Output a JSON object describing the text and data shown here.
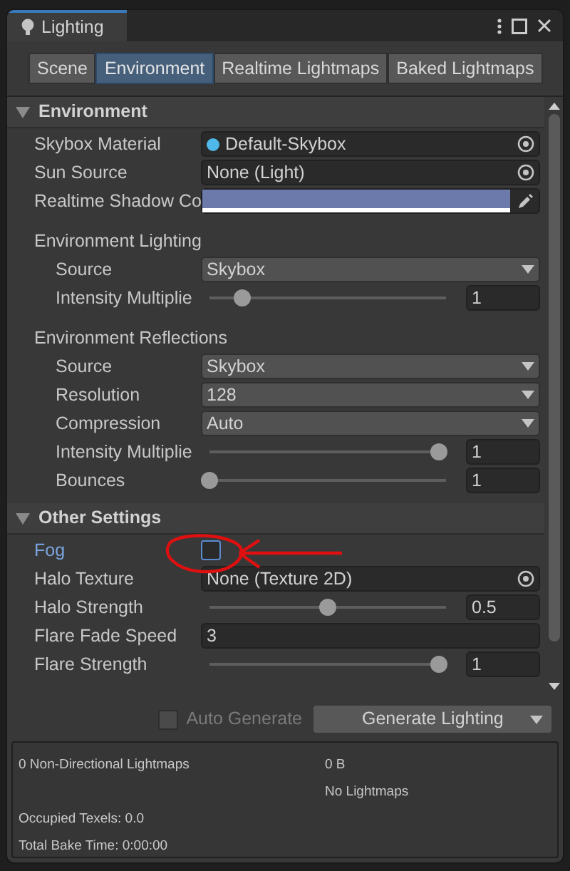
{
  "window": {
    "title": "Lighting"
  },
  "tabs": [
    {
      "label": "Scene",
      "selected": false
    },
    {
      "label": "Environment",
      "selected": true
    },
    {
      "label": "Realtime Lightmaps",
      "selected": false
    },
    {
      "label": "Baked Lightmaps",
      "selected": false
    }
  ],
  "sections": [
    {
      "title": "Environment",
      "expanded": true,
      "rows": [
        {
          "kind": "material",
          "label": "Skybox Material",
          "value": "Default-Skybox"
        },
        {
          "kind": "object",
          "label": "Sun Source",
          "value": "None (Light)"
        },
        {
          "kind": "color",
          "label": "Realtime Shadow Co",
          "color": "#6b7aab"
        },
        {
          "kind": "heading",
          "label": "Environment Lighting"
        },
        {
          "kind": "dropdown",
          "label": "Source",
          "value": "Skybox",
          "indent": true
        },
        {
          "kind": "slider",
          "label": "Intensity Multiplie",
          "level": 0.14,
          "value": "1",
          "indent": true
        },
        {
          "kind": "heading",
          "label": "Environment Reflections"
        },
        {
          "kind": "dropdown",
          "label": "Source",
          "value": "Skybox",
          "indent": true
        },
        {
          "kind": "dropdown",
          "label": "Resolution",
          "value": "128",
          "indent": true
        },
        {
          "kind": "dropdown",
          "label": "Compression",
          "value": "Auto",
          "indent": true
        },
        {
          "kind": "slider",
          "label": "Intensity Multiplie",
          "level": 0.97,
          "value": "1",
          "indent": true
        },
        {
          "kind": "slider",
          "label": "Bounces",
          "level": 0.0,
          "value": "1",
          "indent": true
        }
      ]
    },
    {
      "title": "Other Settings",
      "expanded": true,
      "rows": [
        {
          "kind": "checkbox",
          "label": "Fog",
          "checked": false,
          "focused": true
        },
        {
          "kind": "object",
          "label": "Halo Texture",
          "value": "None (Texture 2D)"
        },
        {
          "kind": "slider",
          "label": "Halo Strength",
          "level": 0.5,
          "value": "0.5"
        },
        {
          "kind": "number",
          "label": "Flare Fade Speed",
          "value": "3"
        },
        {
          "kind": "slider",
          "label": "Flare Strength",
          "level": 0.97,
          "value": "1"
        }
      ]
    }
  ],
  "auto_generate": {
    "label": "Auto Generate",
    "checked": false,
    "disabled": true
  },
  "generate_button": "Generate Lighting",
  "stats": {
    "lightmaps": "0 Non-Directional Lightmaps",
    "size": "0 B",
    "note": "No Lightmaps",
    "texels": "Occupied Texels: 0.0",
    "bake_time": "Total Bake Time: 0:00:00"
  }
}
